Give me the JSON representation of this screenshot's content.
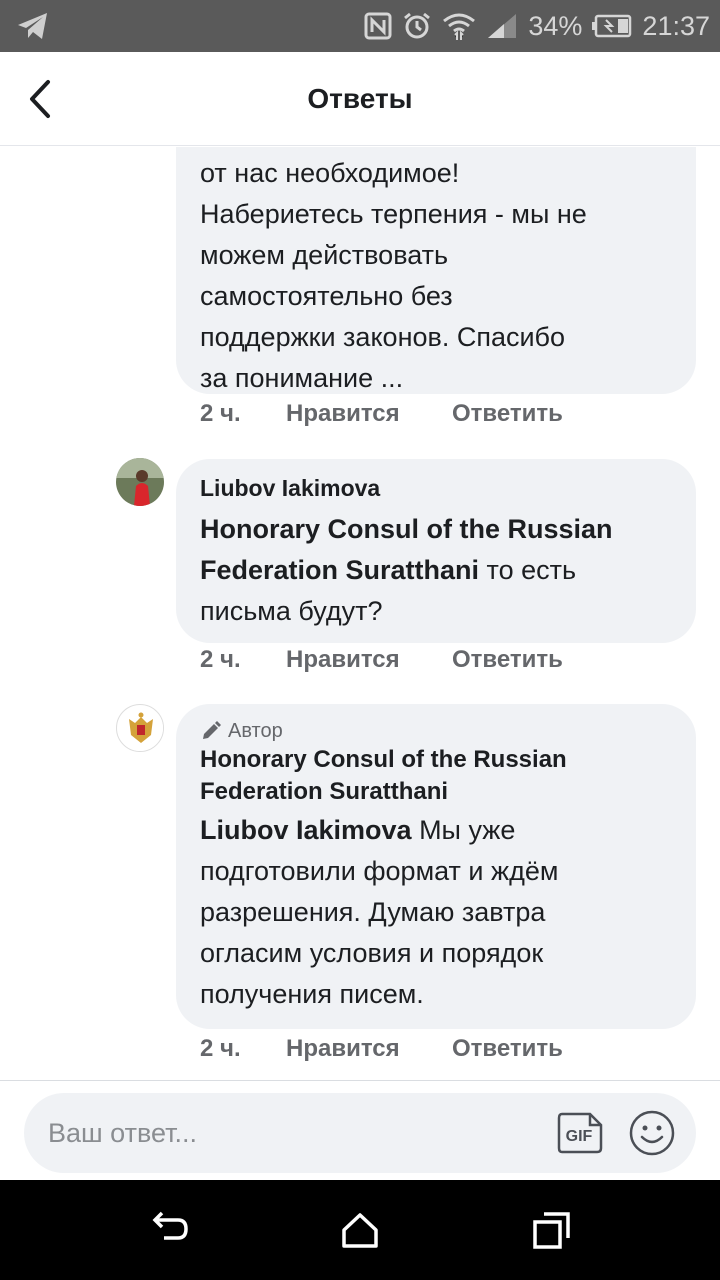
{
  "status_bar": {
    "battery": "34%",
    "time": "21:37"
  },
  "header": {
    "title": "Ответы"
  },
  "comments": [
    {
      "text": "от нас необходимое! Набериетесь терпения - мы не можем действовать самостоятельно без поддержки законов. Спасибо за понимание ...",
      "lines": [
        "от нас необходимое!",
        "Набериетесь терпения - мы не",
        "можем действовать",
        "самостоятельно без",
        "поддержки законов. Спасибо",
        "за понимание ..."
      ],
      "time": "2 ч.",
      "like": "Нравится",
      "reply": "Ответить"
    },
    {
      "author": "Liubov Iakimova",
      "mention_lines": [
        "Honorary Consul of the Russian",
        "Federation Suratthani"
      ],
      "text_after": " то есть",
      "last_line": "письма будут?",
      "time": "2 ч.",
      "like": "Нравится",
      "reply": "Ответить"
    },
    {
      "badge": "Автор",
      "author_lines": [
        "Honorary Consul of the Russian",
        "Federation Suratthani"
      ],
      "mention": "Liubov Iakimova",
      "first_line_rest": " Мы уже",
      "lines": [
        "подготовили формат и ждём",
        "разрешения. Думаю завтра",
        "огласим условия и порядок",
        "получения писем."
      ],
      "time": "2 ч.",
      "like": "Нравится",
      "reply": "Ответить"
    }
  ],
  "composer": {
    "placeholder": "Ваш ответ...",
    "gif_label": "GIF"
  },
  "colors": {
    "bubble": "#f0f2f5",
    "meta_text": "#65676b",
    "status_bar": "#5a5a5a",
    "nav_bar": "#000000"
  },
  "icons": [
    "telegram-icon",
    "nfc-icon",
    "alarm-icon",
    "wifi-icon",
    "signal-icon",
    "battery-icon",
    "back-arrow-icon",
    "pencil-icon",
    "gif-icon",
    "emoji-icon",
    "nav-back-icon",
    "nav-home-icon",
    "nav-recents-icon"
  ]
}
